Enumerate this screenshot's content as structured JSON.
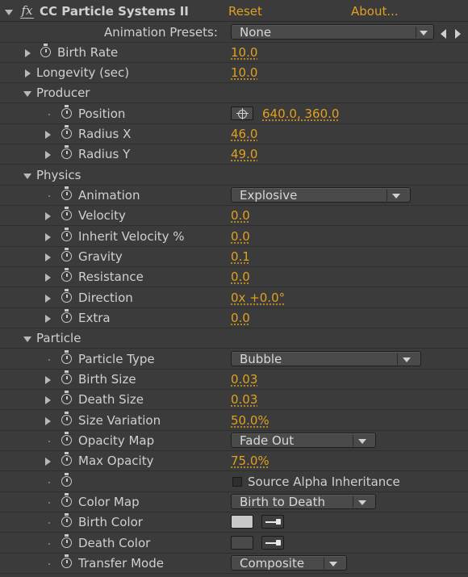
{
  "header": {
    "effect_name": "CC Particle Systems II",
    "reset": "Reset",
    "about": "About...",
    "fx_glyph": "fx",
    "presets_label": "Animation Presets:",
    "presets_value": "None"
  },
  "params": {
    "birth_rate": {
      "label": "Birth Rate",
      "value": "10.0"
    },
    "longevity": {
      "label": "Longevity (sec)",
      "value": "10.0"
    },
    "producer": {
      "label": "Producer",
      "position": {
        "label": "Position",
        "value": "640.0, 360.0"
      },
      "radius_x": {
        "label": "Radius X",
        "value": "46.0"
      },
      "radius_y": {
        "label": "Radius Y",
        "value": "49.0"
      }
    },
    "physics": {
      "label": "Physics",
      "animation": {
        "label": "Animation",
        "value": "Explosive"
      },
      "velocity": {
        "label": "Velocity",
        "value": "0.0"
      },
      "inherit_velocity": {
        "label": "Inherit Velocity %",
        "value": "0.0"
      },
      "gravity": {
        "label": "Gravity",
        "value": "0.1"
      },
      "resistance": {
        "label": "Resistance",
        "value": "0.0"
      },
      "direction": {
        "label": "Direction",
        "value": "0x +0.0°"
      },
      "extra": {
        "label": "Extra",
        "value": "0.0"
      }
    },
    "particle": {
      "label": "Particle",
      "particle_type": {
        "label": "Particle Type",
        "value": "Bubble"
      },
      "birth_size": {
        "label": "Birth Size",
        "value": "0.03"
      },
      "death_size": {
        "label": "Death Size",
        "value": "0.03"
      },
      "size_variation": {
        "label": "Size Variation",
        "value": "50.0%"
      },
      "opacity_map": {
        "label": "Opacity Map",
        "value": "Fade Out"
      },
      "max_opacity": {
        "label": "Max Opacity",
        "value": "75.0%"
      },
      "source_alpha": {
        "label": "Source Alpha Inheritance",
        "checked": false
      },
      "color_map": {
        "label": "Color Map",
        "value": "Birth to Death"
      },
      "birth_color": {
        "label": "Birth Color",
        "color": "#c8c8c8"
      },
      "death_color": {
        "label": "Death Color",
        "color": "#4a4a4a"
      },
      "transfer_mode": {
        "label": "Transfer Mode",
        "value": "Composite"
      }
    }
  },
  "colors": {
    "background": "#3b3b3b",
    "value_accent": "#e0a020",
    "label": "#d0d0d0"
  }
}
